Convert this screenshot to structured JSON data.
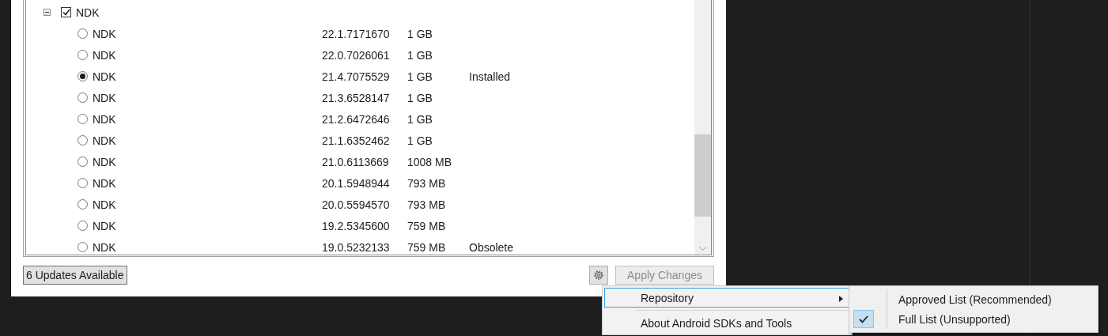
{
  "tree": {
    "label": "NDK",
    "expanded": true,
    "checked": true,
    "children": [
      {
        "label": "NDK",
        "version": "22.1.7171670",
        "size": "1 GB",
        "selected": false
      },
      {
        "label": "NDK",
        "version": "22.0.7026061",
        "size": "1 GB",
        "selected": false
      },
      {
        "label": "NDK",
        "version": "21.4.7075529",
        "size": "1 GB",
        "status": "Installed",
        "selected": true
      },
      {
        "label": "NDK",
        "version": "21.3.6528147",
        "size": "1 GB",
        "selected": false
      },
      {
        "label": "NDK",
        "version": "21.2.6472646",
        "size": "1 GB",
        "selected": false
      },
      {
        "label": "NDK",
        "version": "21.1.6352462",
        "size": "1 GB",
        "selected": false
      },
      {
        "label": "NDK",
        "version": "21.0.6113669",
        "size": "1008 MB",
        "selected": false
      },
      {
        "label": "NDK",
        "version": "20.1.5948944",
        "size": "793 MB",
        "selected": false
      },
      {
        "label": "NDK",
        "version": "20.0.5594570",
        "size": "793 MB",
        "selected": false
      },
      {
        "label": "NDK",
        "version": "19.2.5345600",
        "size": "759 MB",
        "selected": false
      },
      {
        "label": "NDK",
        "version": "19.0.5232133",
        "size": "759 MB",
        "status": "Obsolete",
        "selected": false
      }
    ]
  },
  "updates_button": "6 Updates Available",
  "apply_button": {
    "label": "Apply Changes",
    "disabled": true
  },
  "menu": {
    "items": [
      {
        "label": "Repository",
        "kind": "submenu",
        "highlighted": true
      },
      {
        "label": "About Android SDKs and Tools",
        "kind": "item",
        "highlighted": false
      }
    ]
  },
  "submenu": {
    "items": [
      {
        "label": "Approved List (Recommended)",
        "checked": false
      },
      {
        "label": "Full List (Unsupported)",
        "checked": true
      }
    ]
  }
}
